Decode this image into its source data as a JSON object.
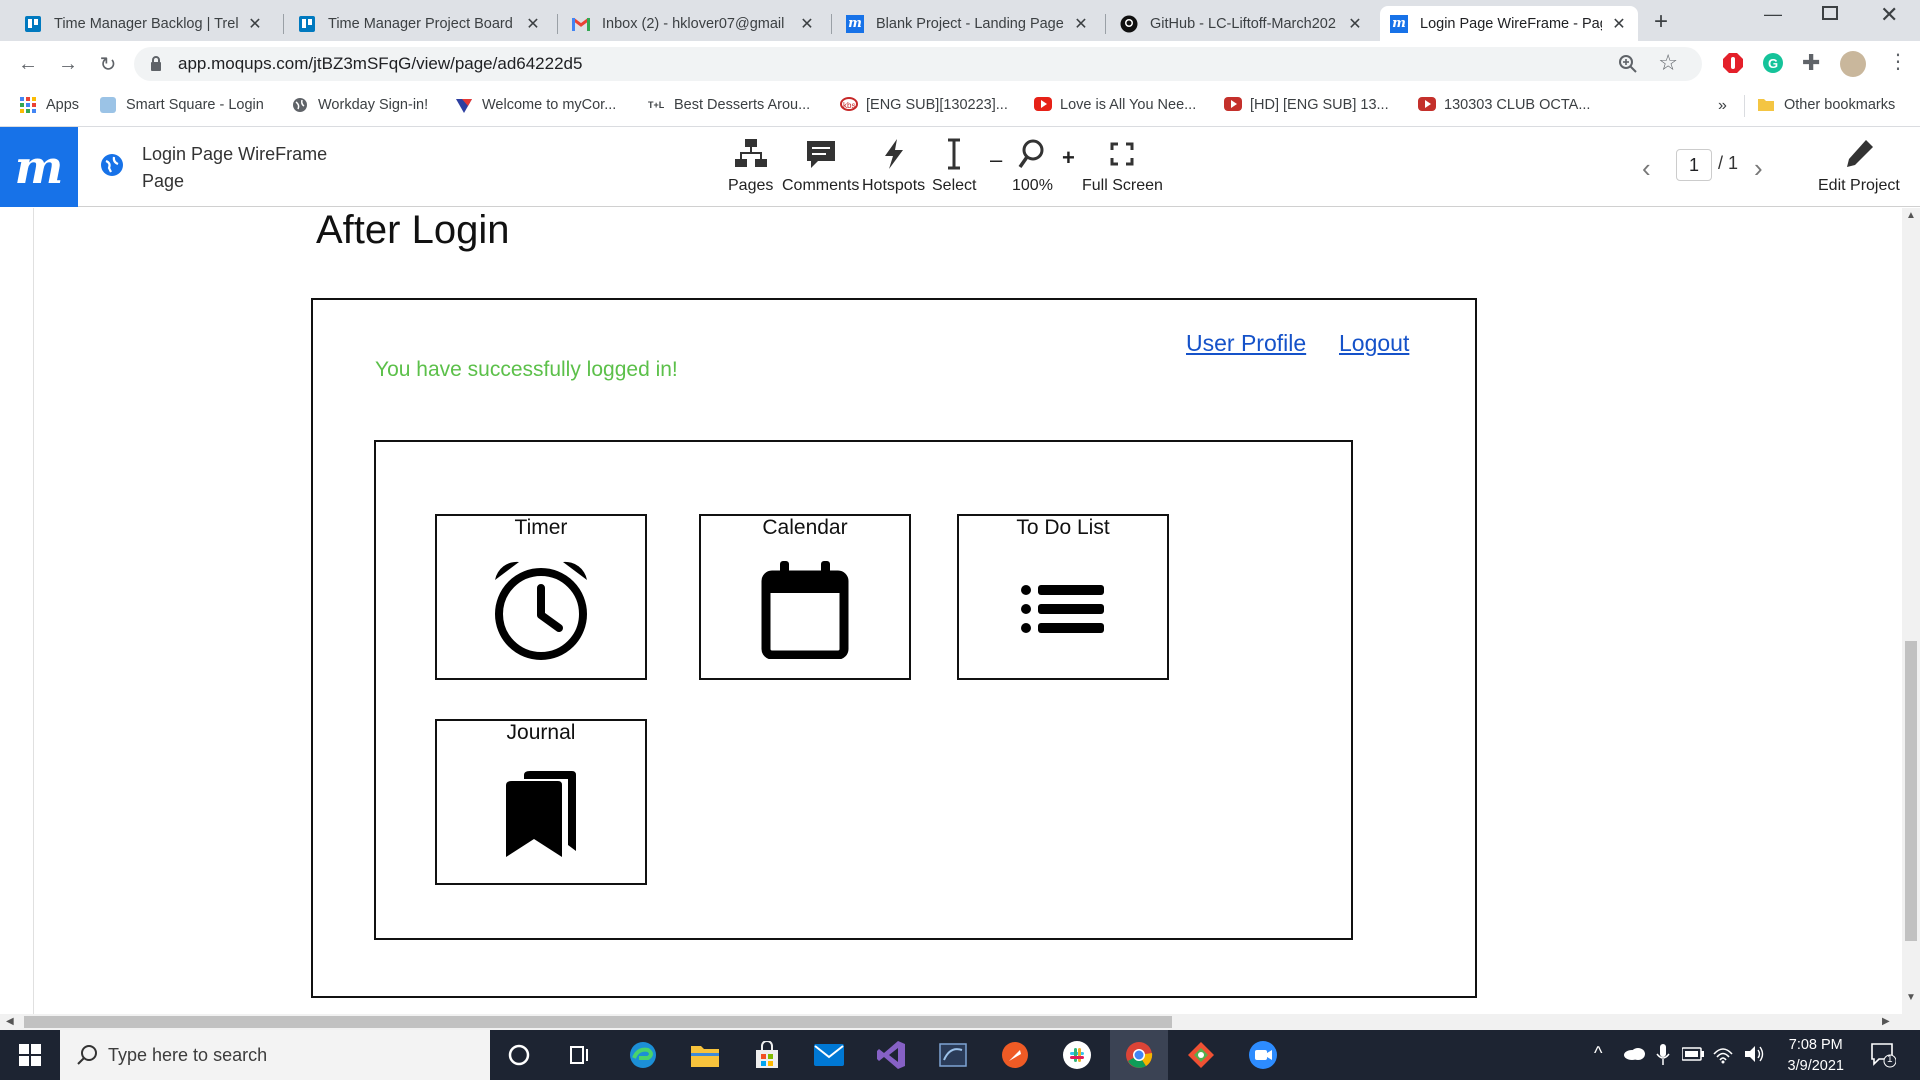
{
  "browser": {
    "tabs": [
      {
        "title": "Time Manager Backlog | Trell",
        "icon": "trello-icon",
        "color": "#0079bf",
        "active": false
      },
      {
        "title": "Time Manager Project Board",
        "icon": "trello-icon",
        "color": "#0079bf",
        "active": false
      },
      {
        "title": "Inbox (2) - hklover07@gmail",
        "icon": "gmail-icon",
        "color": "#ea4335",
        "active": false
      },
      {
        "title": "Blank Project - Landing Page",
        "icon": "moqups-icon",
        "color": "#1772e8",
        "active": false
      },
      {
        "title": "GitHub - LC-Liftoff-March202",
        "icon": "github-icon",
        "color": "#111111",
        "active": false
      },
      {
        "title": "Login Page WireFrame - Page",
        "icon": "moqups-icon",
        "color": "#1772e8",
        "active": true
      }
    ],
    "new_tab": "+",
    "url": "app.moqups.com/jtBZ3mSFqG/view/page/ad64222d5",
    "bookmarks": [
      {
        "label": "Apps",
        "icon": "apps-grid-icon"
      },
      {
        "label": "Smart Square - Login",
        "icon": "smart-square-icon"
      },
      {
        "label": "Workday Sign-in!",
        "icon": "globe-icon"
      },
      {
        "label": "Welcome to myCor...",
        "icon": "mycor-icon"
      },
      {
        "label": "Best Desserts Arou...",
        "icon": "tl-icon"
      },
      {
        "label": "[ENG SUB][130223]...",
        "icon": "kbs-icon"
      },
      {
        "label": "Love is All You Nee...",
        "icon": "youtube-icon"
      },
      {
        "label": "[HD] [ENG SUB] 13...",
        "icon": "youtube-icon"
      },
      {
        "label": "130303 CLUB OCTA...",
        "icon": "youtube-icon"
      }
    ],
    "more_bookmarks": "»",
    "other_bookmarks": "Other bookmarks",
    "apps_label": "Apps"
  },
  "app": {
    "logo": "m",
    "doc_title": "Login Page WireFrame Page",
    "toolbar": {
      "pages": "Pages",
      "comments": "Comments",
      "hotspots": "Hotspots",
      "select": "Select",
      "zoom_minus": "–",
      "zoom_plus": "+",
      "zoom": "100%",
      "fullscreen": "Full Screen"
    },
    "pager": {
      "current": "1",
      "total": "/ 1"
    },
    "edit": "Edit Project"
  },
  "wireframe": {
    "heading": "After Login",
    "user_profile": "User Profile",
    "logout": "Logout",
    "success": "You have successfully logged in!",
    "success_color": "#5cc04a",
    "link_color": "#1552c9",
    "cards": [
      {
        "label": "Timer",
        "icon": "alarm-clock-icon"
      },
      {
        "label": "Calendar",
        "icon": "calendar-icon"
      },
      {
        "label": "To Do List",
        "icon": "list-icon"
      },
      {
        "label": "Journal",
        "icon": "bookmarks-icon"
      }
    ]
  },
  "taskbar": {
    "search_placeholder": "Type here to search",
    "apps": [
      "cortana-icon",
      "task-view-icon",
      "edge-icon",
      "file-explorer-icon",
      "store-icon",
      "mail-icon",
      "visual-studio-icon",
      "sql-icon",
      "postman-icon",
      "slack-icon",
      "chrome-icon",
      "git-icon",
      "zoom-icon"
    ],
    "time": "7:08 PM",
    "date": "3/9/2021",
    "notifications": "1"
  }
}
